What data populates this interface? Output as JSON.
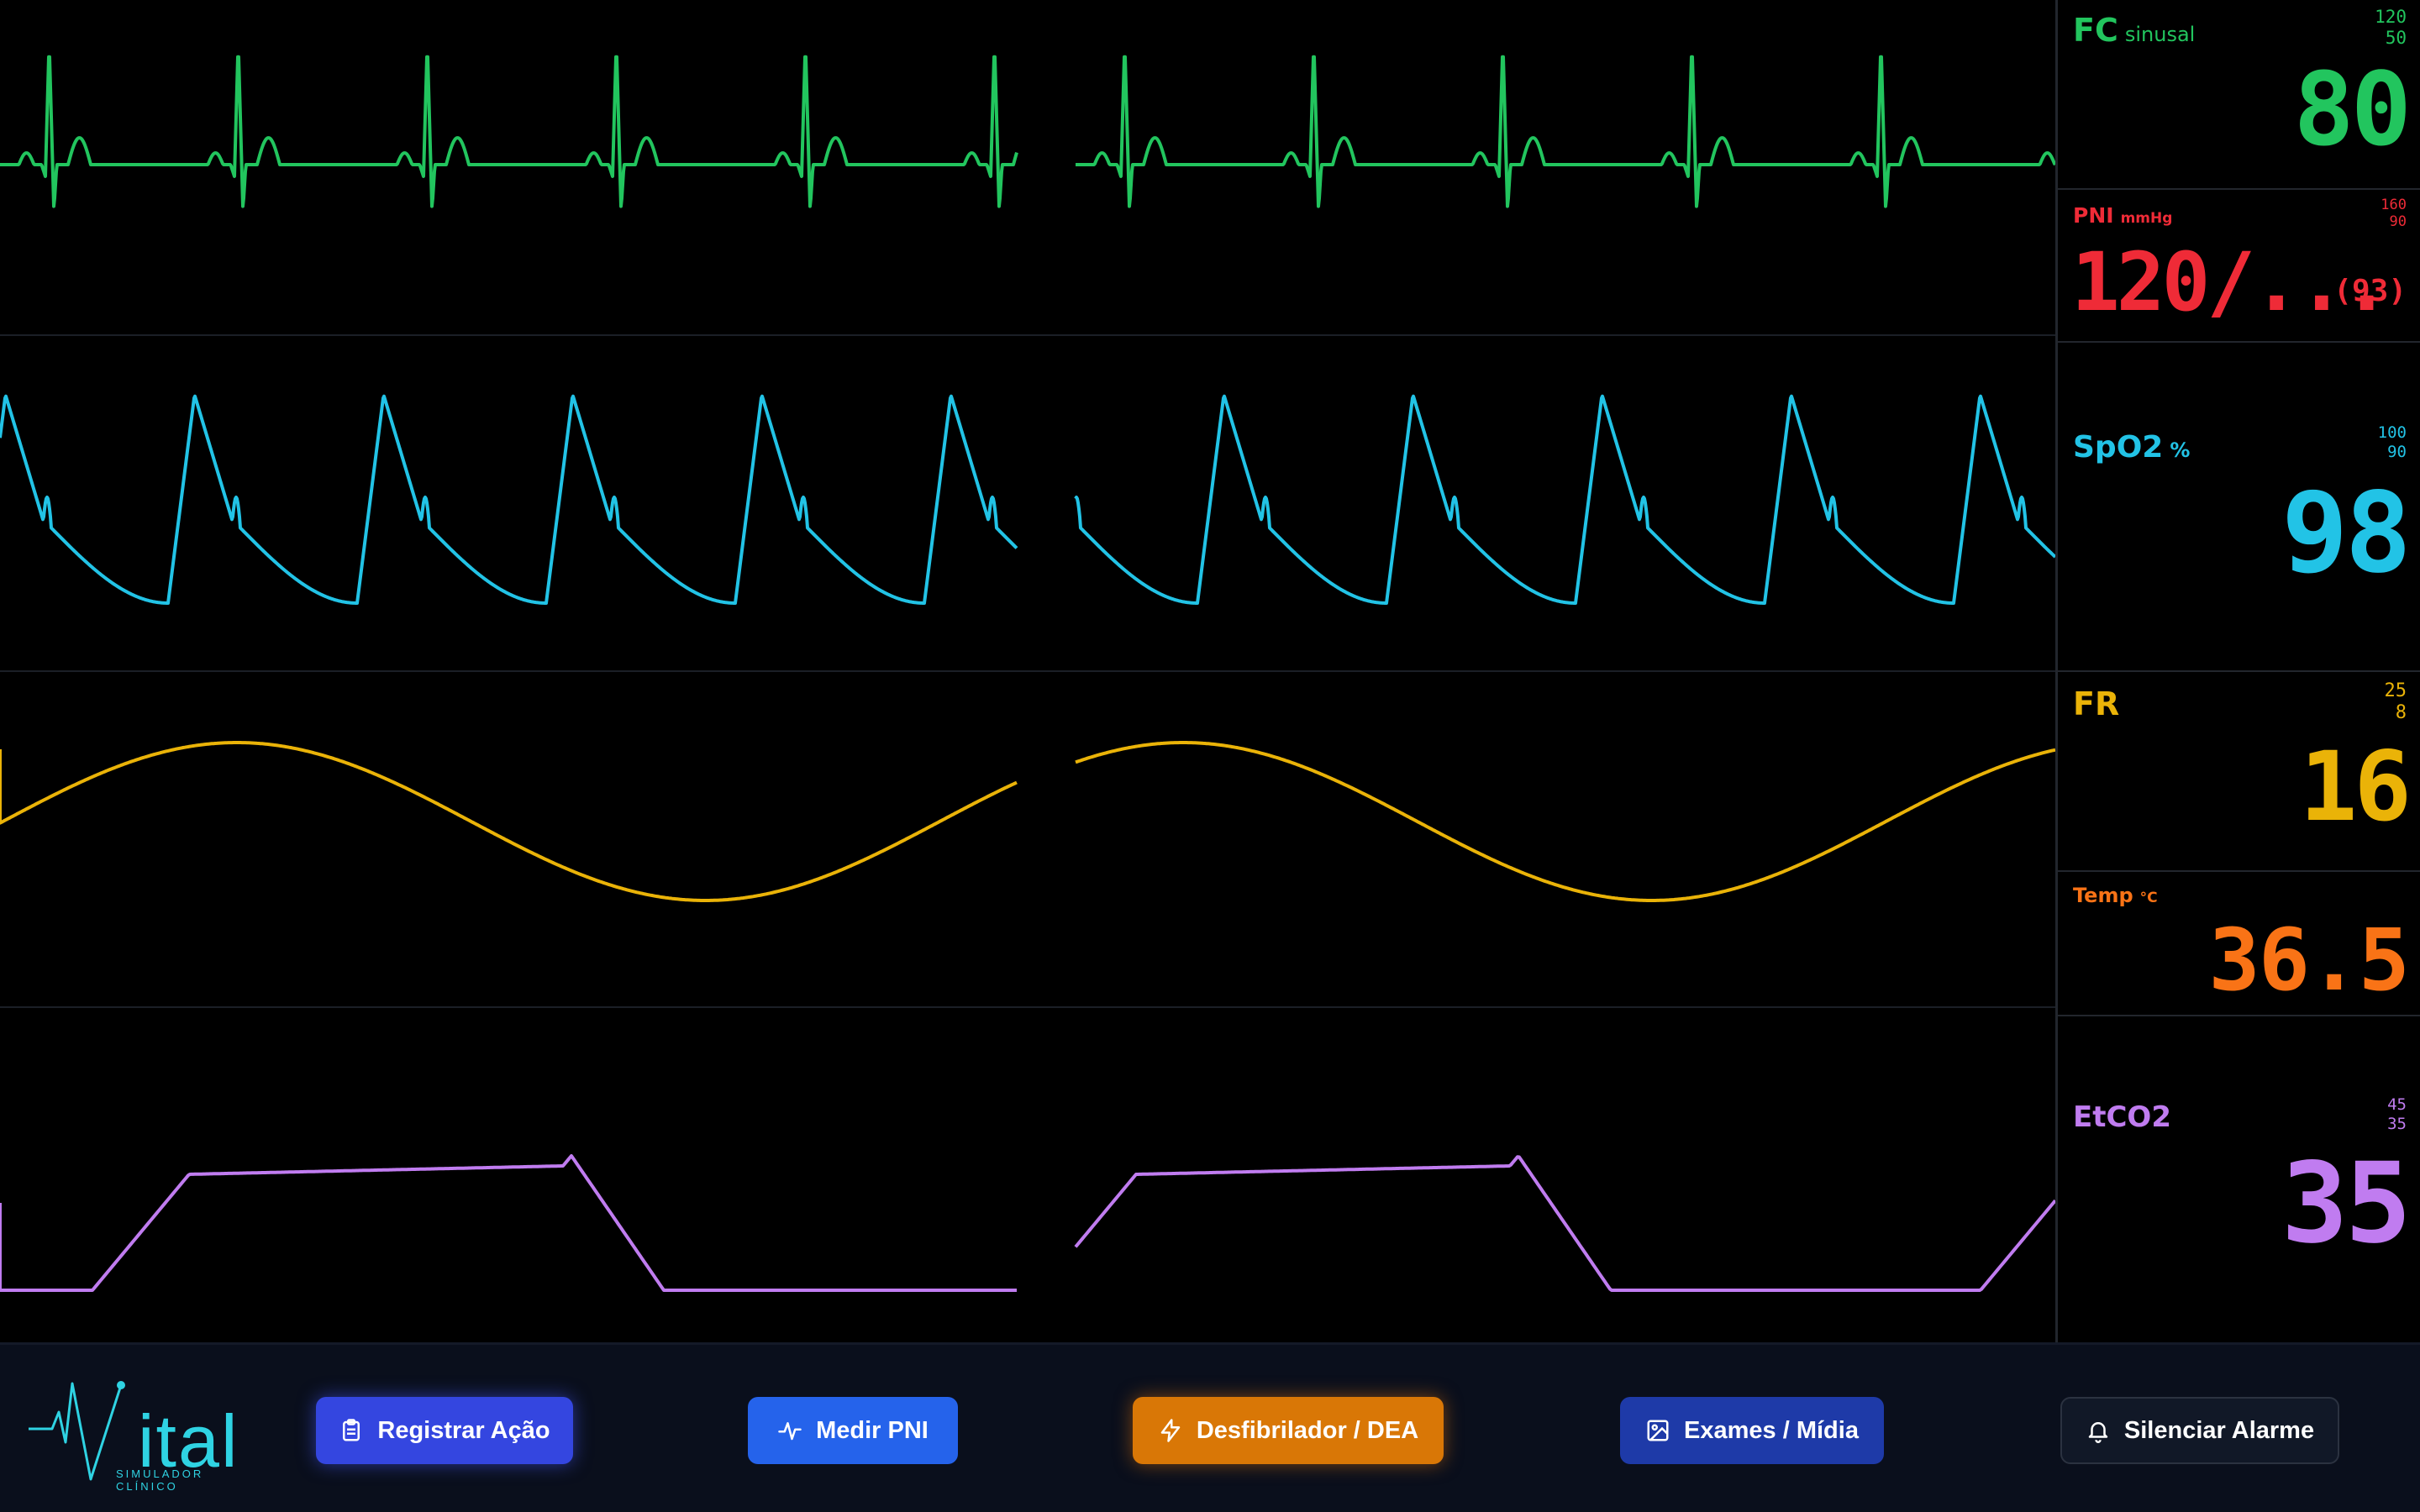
{
  "colors": {
    "ecg": "#22c55e",
    "spo2": "#22c3e6",
    "resp": "#eab308",
    "nibp": "#ef2b37",
    "temp": "#f97316",
    "etco2": "#c07cf0"
  },
  "vitals": {
    "fc": {
      "label": "FC",
      "unit": "sinusal",
      "high": "120",
      "low": "50",
      "value": "80"
    },
    "pni": {
      "label": "PNI",
      "unit": "mmHg",
      "high": "160",
      "low": "90",
      "value": "120/...",
      "mean": "(93)"
    },
    "spo2": {
      "label": "SpO2",
      "unit": "%",
      "high": "100",
      "low": "90",
      "value": "98"
    },
    "fr": {
      "label": "FR",
      "high": "25",
      "low": "8",
      "value": "16"
    },
    "temp": {
      "label": "Temp",
      "unit": "°C",
      "value": "36.5"
    },
    "etco2": {
      "label": "EtCO2",
      "high": "45",
      "low": "35",
      "value": "35"
    }
  },
  "footer": {
    "logo_text": "ital",
    "logo_sub": "SIMULADOR CLÍNICO",
    "buttons": {
      "registrar": "Registrar Ação",
      "medir_pni": "Medir PNI",
      "desfibrilador": "Desfibrilador / DEA",
      "exames": "Exames / Mídia",
      "silenciar": "Silenciar Alarme"
    },
    "icons": {
      "registrar": "clipboard-icon",
      "medir_pni": "pulse-icon",
      "desfibrilador": "lightning-icon",
      "exames": "image-icon",
      "silenciar": "bell-icon"
    }
  }
}
